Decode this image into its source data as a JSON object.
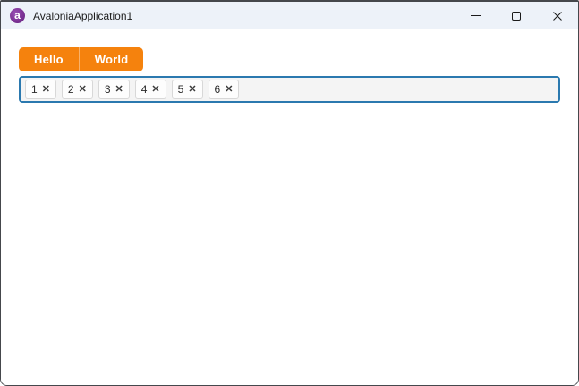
{
  "window": {
    "title": "AvaloniaApplication1",
    "icon": "avalonia-logo",
    "icon_letter": "a",
    "controls": {
      "minimize": "minimize-icon",
      "maximize": "maximize-icon",
      "close": "close-icon"
    }
  },
  "tabs": {
    "items": [
      {
        "label": "Hello"
      },
      {
        "label": "World"
      }
    ]
  },
  "chips": {
    "items": [
      "1",
      "2",
      "3",
      "4",
      "5",
      "6"
    ],
    "remove_glyph": "✕"
  },
  "colors": {
    "tab_accent_orange": "#F5820D",
    "focus_border_blue": "#2B79AF",
    "titlebar_background": "#EDF2F9",
    "chip_background": "#FDFDFD",
    "input_background": "#F4F4F4"
  }
}
